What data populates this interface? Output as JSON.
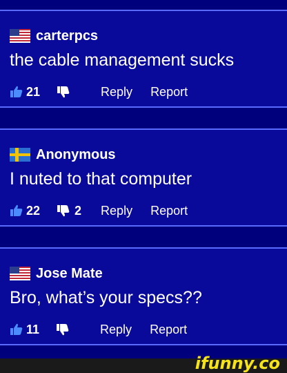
{
  "comments": [
    {
      "user": "carterpcs",
      "flag": "us-flag-icon",
      "text": "the cable management sucks",
      "likes": "21",
      "dislikes": "",
      "reply_label": "Reply",
      "report_label": "Report"
    },
    {
      "user": "Anonymous",
      "flag": "sweden-flag-icon",
      "text": "I nuted to that computer",
      "likes": "22",
      "dislikes": "2",
      "reply_label": "Reply",
      "report_label": "Report"
    },
    {
      "user": "Jose Mate",
      "flag": "us-flag-icon",
      "text": "Bro, what’s your specs??",
      "likes": "11",
      "dislikes": "",
      "reply_label": "Reply",
      "report_label": "Report"
    }
  ],
  "footer": {
    "logo": "ifunny.co"
  },
  "colors": {
    "background": "#00008a",
    "card": "#0a0a9a",
    "border": "#5a6cff",
    "logo": "#f4e21a",
    "thumbs_up": "#4a8cff"
  }
}
